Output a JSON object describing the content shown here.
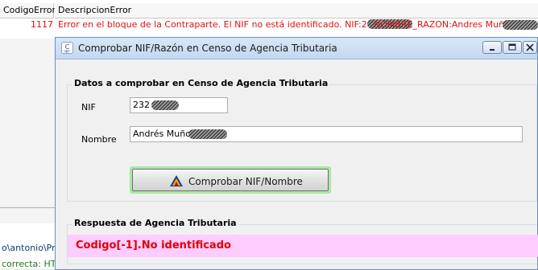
{
  "background_grid": {
    "columns": [
      "CodigoError",
      "DescripcionError"
    ],
    "row": {
      "code": "1117",
      "description_prefix": "Error en el bloque de la Contraparte. El NIF no está identificado. NIF:2",
      "description_suffix": "NOMBRE_RAZON:Andres Muño"
    }
  },
  "background_panel": {
    "line1": "o\\antonio\\Proy",
    "line2": "correcta: HTT"
  },
  "dialog": {
    "title": "Comprobar NIF/Razón en Censo de Agencia Tributaria",
    "input_section": {
      "title": "Datos a comprobar en Censo de Agencia Tributaria",
      "nif_label": "NIF",
      "nif_value": "232",
      "nombre_label": "Nombre",
      "nombre_value": "Andrés Muñoz"
    },
    "check_button_label": "Comprobar NIF/Nombre",
    "response_section": {
      "title": "Respuesta de Agencia Tributaria",
      "result_text": "Codigo[-1].No identificado"
    }
  },
  "colors": {
    "error_text": "#e01010",
    "result_background": "#ffccff",
    "result_text": "#e00000",
    "button_focus_border": "#a6e8a2"
  }
}
